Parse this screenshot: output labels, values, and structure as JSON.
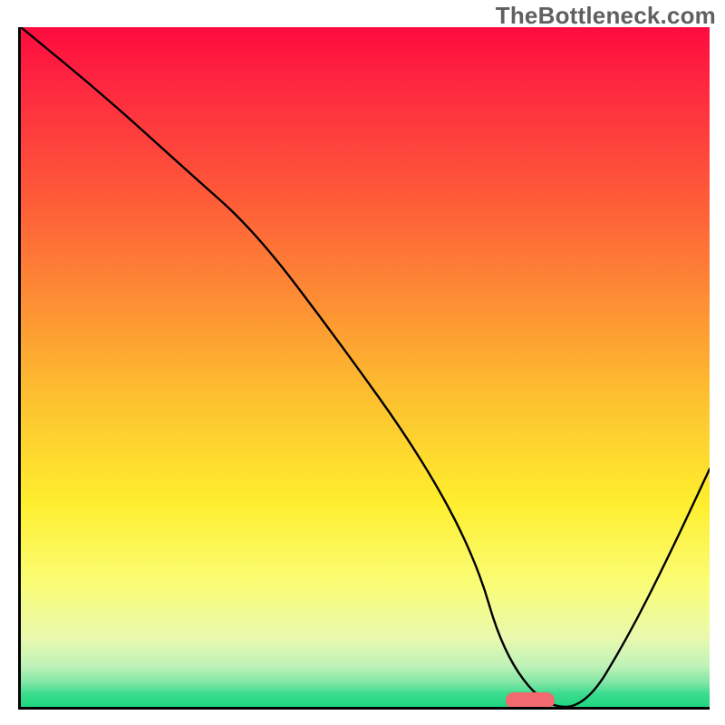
{
  "watermark": "TheBottleneck.com",
  "colors": {
    "curve": "#000000",
    "marker": "#f26a6f",
    "axis": "#000000"
  },
  "marker": {
    "x_pct": 74,
    "y_pct": 99
  },
  "chart_data": {
    "type": "line",
    "title": "",
    "xlabel": "",
    "ylabel": "",
    "xlim": [
      0,
      100
    ],
    "ylim": [
      0,
      100
    ],
    "grid": false,
    "series": [
      {
        "name": "curve",
        "x": [
          0,
          12,
          24,
          34,
          46,
          58,
          66,
          70,
          76,
          82,
          88,
          94,
          100
        ],
        "y": [
          100,
          90,
          79,
          70,
          54,
          37,
          22,
          8,
          0,
          0,
          10,
          22,
          35
        ]
      }
    ],
    "annotations": [
      {
        "type": "pill",
        "x": 74,
        "y": 0,
        "color": "#f26a6f"
      }
    ],
    "background": {
      "type": "vertical_gradient",
      "stops": [
        {
          "pos": 0.0,
          "color": "#fd0b3e"
        },
        {
          "pos": 0.24,
          "color": "#fe5739"
        },
        {
          "pos": 0.4,
          "color": "#fd8d34"
        },
        {
          "pos": 0.55,
          "color": "#fdc22f"
        },
        {
          "pos": 0.7,
          "color": "#feee2e"
        },
        {
          "pos": 0.82,
          "color": "#fafd77"
        },
        {
          "pos": 0.9,
          "color": "#e8f9af"
        },
        {
          "pos": 0.965,
          "color": "#7fe6a5"
        },
        {
          "pos": 1.0,
          "color": "#1dd67f"
        }
      ]
    }
  }
}
